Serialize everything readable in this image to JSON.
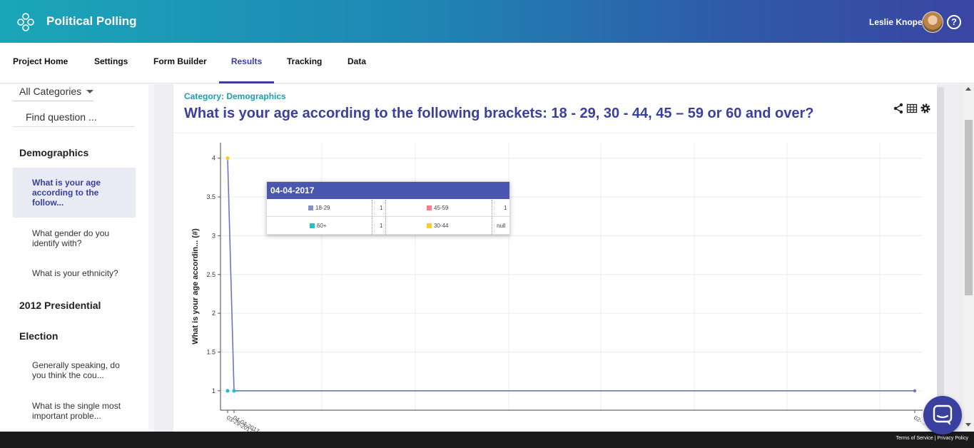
{
  "app": {
    "title": "Political Polling",
    "user_name": "Leslie Knope",
    "help_label": "?"
  },
  "tabs": [
    {
      "label": "Project Home"
    },
    {
      "label": "Settings"
    },
    {
      "label": "Form Builder"
    },
    {
      "label": "Results",
      "active": true
    },
    {
      "label": "Tracking"
    },
    {
      "label": "Data"
    }
  ],
  "sidebar": {
    "category_select": "All Categories",
    "find_placeholder": "Find question ...",
    "groups": [
      {
        "heading": "Demographics",
        "items": [
          {
            "label": "What is your age according to the follow...",
            "active": true
          },
          {
            "label": "What gender do you identify with?"
          },
          {
            "label": "What is your ethnicity?"
          }
        ]
      },
      {
        "heading": "2012 Presidential",
        "heading2": "Election",
        "items": [
          {
            "label": "Generally speaking, do you think the cou..."
          },
          {
            "label": "What is the single most important proble..."
          }
        ]
      }
    ]
  },
  "question": {
    "category": "Category: Demographics",
    "title": "What is your age according to the following brackets: 18 - 29, 30 - 44, 45 – 59 or 60 and over?",
    "actions": [
      "share-icon",
      "table-icon",
      "gear-icon"
    ]
  },
  "tooltip": {
    "date": "04-04-2017",
    "rows": [
      [
        {
          "label": "18-29",
          "value": "1",
          "color": "#8a8fc8"
        },
        {
          "label": "45-59",
          "value": "1",
          "color": "#f08090"
        }
      ],
      [
        {
          "label": "60+",
          "value": "1",
          "color": "#20c0d0"
        },
        {
          "label": "30-44",
          "value": "null",
          "color": "#f5d020"
        }
      ]
    ]
  },
  "chart_data": {
    "type": "line",
    "ylabel": "What is your age accordin... (#)",
    "ylim": [
      0.75,
      4.2
    ],
    "yticks": [
      "1",
      "1.5",
      "2",
      "2.5",
      "3",
      "3.5",
      "4"
    ],
    "xtick_labels": [
      "03-29-2017",
      "04-04-2017",
      "02-..."
    ],
    "series": [
      {
        "name": "18-29",
        "color": "#6b74c8",
        "points": [
          {
            "x": 0,
            "y": 4
          },
          {
            "x": 1,
            "y": 1
          },
          {
            "x": 100,
            "y": 1
          }
        ]
      },
      {
        "name": "30-44",
        "color": "#f5d020",
        "points": [
          {
            "x": 0,
            "y": 4
          }
        ]
      },
      {
        "name": "60+",
        "color": "#20c0d0",
        "points": [
          {
            "x": 0,
            "y": 1
          },
          {
            "x": 1,
            "y": 1
          }
        ]
      }
    ]
  },
  "footer": {
    "terms": "Terms of Service",
    "privacy": "Privacy Policy"
  }
}
